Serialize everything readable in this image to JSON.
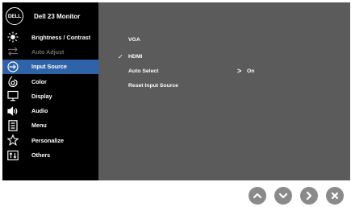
{
  "header": {
    "logo_text": "DELL",
    "model": "Dell 23 Monitor"
  },
  "sidebar": {
    "items": [
      {
        "label": "Brightness / Contrast",
        "icon": "sun-icon",
        "state": "normal"
      },
      {
        "label": "Auto Adjust",
        "icon": "auto-adjust-icon",
        "state": "disabled"
      },
      {
        "label": "Input Source",
        "icon": "input-source-icon",
        "state": "selected"
      },
      {
        "label": "Color",
        "icon": "color-icon",
        "state": "normal"
      },
      {
        "label": "Display",
        "icon": "display-icon",
        "state": "normal"
      },
      {
        "label": "Audio",
        "icon": "speaker-icon",
        "state": "normal"
      },
      {
        "label": "Menu",
        "icon": "menu-icon",
        "state": "normal"
      },
      {
        "label": "Personalize",
        "icon": "star-icon",
        "state": "normal"
      },
      {
        "label": "Others",
        "icon": "others-icon",
        "state": "normal"
      }
    ]
  },
  "panel": {
    "options": [
      {
        "label": "VGA",
        "checked": false
      },
      {
        "label": "HDMI",
        "checked": true
      },
      {
        "label": "Auto Select",
        "value": "On"
      },
      {
        "label": "Reset Input Source"
      }
    ],
    "check_glyph": "✓",
    "chevron_glyph": ">"
  },
  "buttons": [
    "up-button",
    "down-button",
    "right-button",
    "close-button"
  ],
  "colors": {
    "sidebar_bg": "#000000",
    "panel_bg": "#5b5b5b",
    "selected_bg": "#2f63a8",
    "disabled_text": "#6e6e6e",
    "button_bg": "#8a8a8a"
  }
}
